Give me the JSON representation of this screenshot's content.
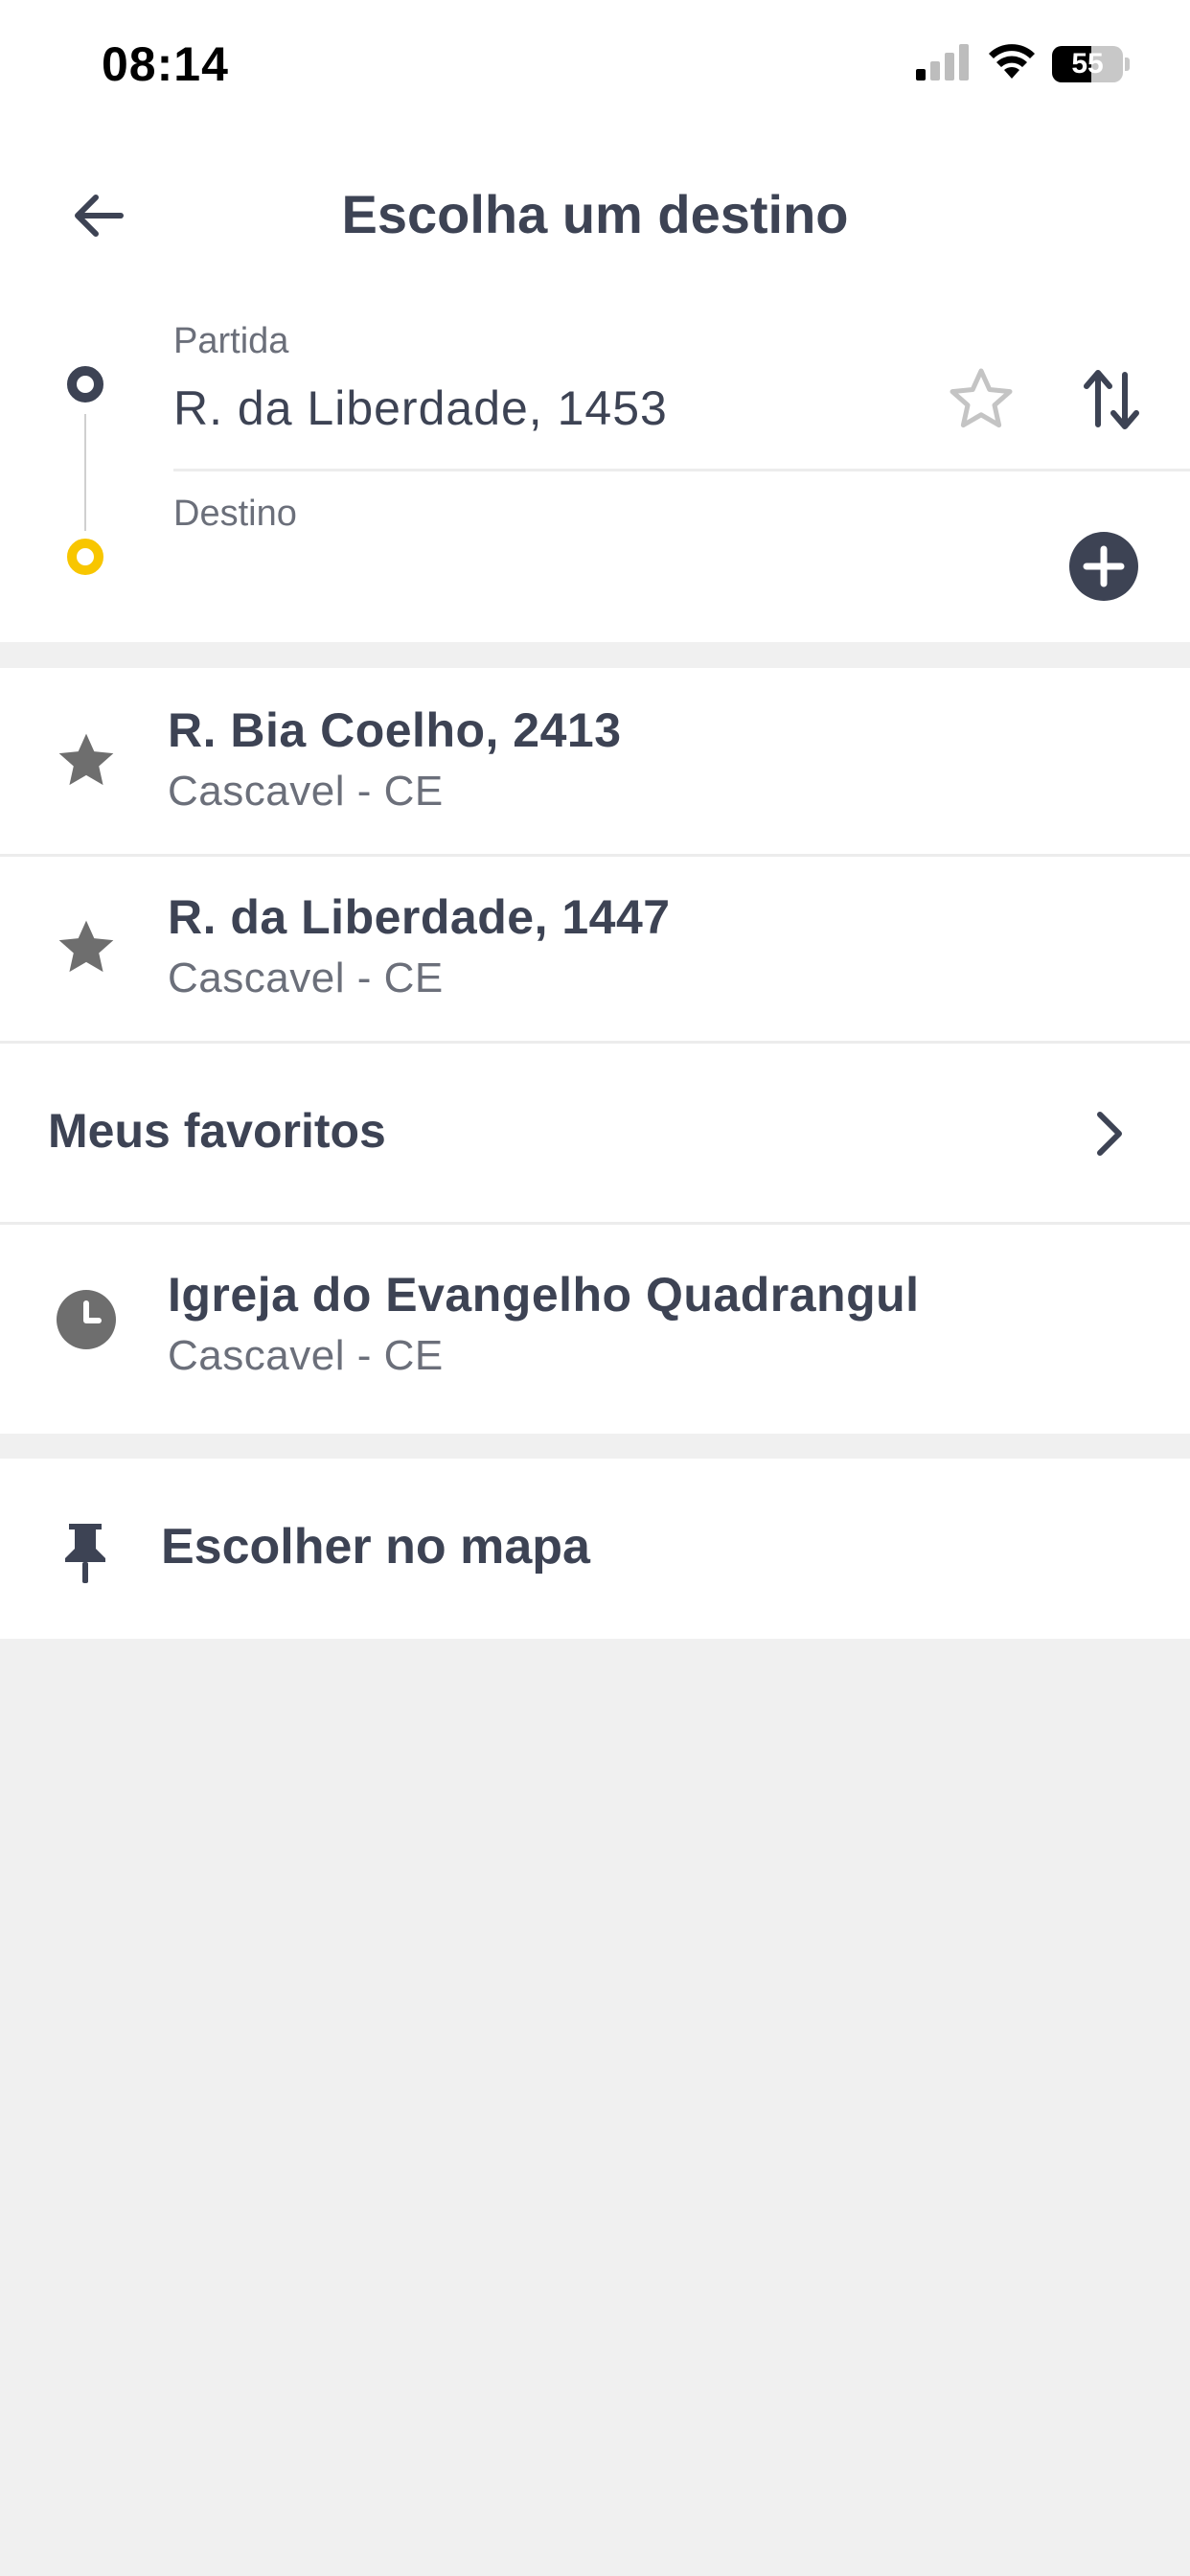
{
  "status_bar": {
    "time": "08:14",
    "battery_level": "55",
    "battery_fraction": 0.55
  },
  "header": {
    "title": "Escolha um destino"
  },
  "route": {
    "origin_label": "Partida",
    "origin_value": "R. da Liberdade, 1453",
    "destination_label": "Destino",
    "destination_value": ""
  },
  "favorites": [
    {
      "title": "R. Bia Coelho, 2413",
      "subtitle": "Cascavel - CE",
      "icon": "star-icon"
    },
    {
      "title": "R. da Liberdade, 1447",
      "subtitle": "Cascavel - CE",
      "icon": "star-icon"
    }
  ],
  "my_favorites_label": "Meus favoritos",
  "recent": [
    {
      "title": "Igreja do Evangelho Quadrangul",
      "subtitle": "Cascavel - CE",
      "icon": "clock-icon"
    }
  ],
  "map_pick_label": "Escolher no mapa",
  "colors": {
    "text_primary": "#3d4354",
    "text_secondary": "#6b6f7a",
    "destination_dot": "#f8c600",
    "icon_gray": "#6e6e6e",
    "background": "#f0f0f0"
  }
}
